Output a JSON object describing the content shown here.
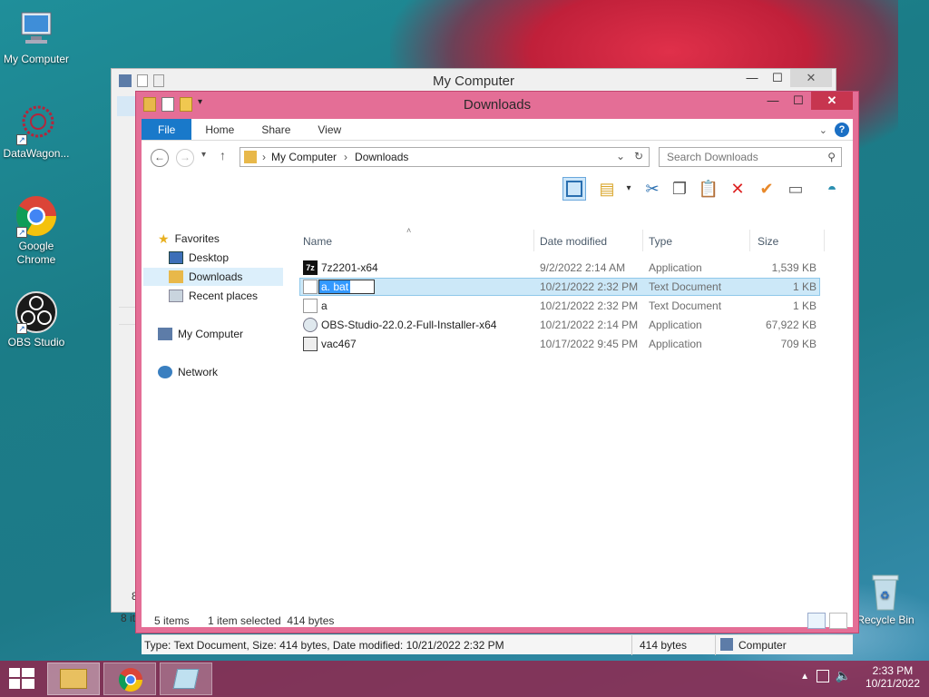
{
  "desktop": {
    "icons": [
      {
        "label": "My Computer"
      },
      {
        "label": "DataWagon..."
      },
      {
        "label": "Google Chrome"
      },
      {
        "label": "OBS Studio"
      },
      {
        "label": "Recycle Bin"
      }
    ]
  },
  "back_window": {
    "title": "My Computer",
    "status_fragment_1": "8",
    "status_fragment_2": "8 it"
  },
  "window": {
    "title": "Downloads",
    "ribbon_tabs": [
      "File",
      "Home",
      "Share",
      "View"
    ],
    "address": {
      "root": "My Computer",
      "current": "Downloads"
    },
    "search": {
      "placeholder": "Search Downloads"
    },
    "nav": {
      "favorites": "Favorites",
      "desktop": "Desktop",
      "downloads": "Downloads",
      "recent": "Recent places",
      "computer": "My Computer",
      "network": "Network"
    },
    "columns": {
      "name": "Name",
      "date": "Date modified",
      "type": "Type",
      "size": "Size"
    },
    "files": [
      {
        "name": "7z2201-x64",
        "date": "9/2/2022 2:14 AM",
        "type": "Application",
        "size": "1,539 KB"
      },
      {
        "name": "a. bat",
        "date": "10/21/2022 2:32 PM",
        "type": "Text Document",
        "size": "1 KB",
        "selected": true,
        "renaming": true
      },
      {
        "name": "a",
        "date": "10/21/2022 2:32 PM",
        "type": "Text Document",
        "size": "1 KB"
      },
      {
        "name": "OBS-Studio-22.0.2-Full-Installer-x64",
        "date": "10/21/2022 2:14 PM",
        "type": "Application",
        "size": "67,922 KB"
      },
      {
        "name": "vac467",
        "date": "10/17/2022 9:45 PM",
        "type": "Application",
        "size": "709 KB"
      }
    ],
    "status": {
      "items": "5 items",
      "selection": "1 item selected  414 bytes"
    },
    "details": {
      "info": "Type: Text Document, Size: 414 bytes, Date modified: 10/21/2022 2:32 PM",
      "size": "414 bytes",
      "location": "Computer"
    }
  },
  "taskbar": {
    "time": "2:33 PM",
    "date": "10/21/2022"
  },
  "colors": {
    "accent": "#1979ca",
    "frame": "#e46e96",
    "taskbar": "#94234b"
  }
}
